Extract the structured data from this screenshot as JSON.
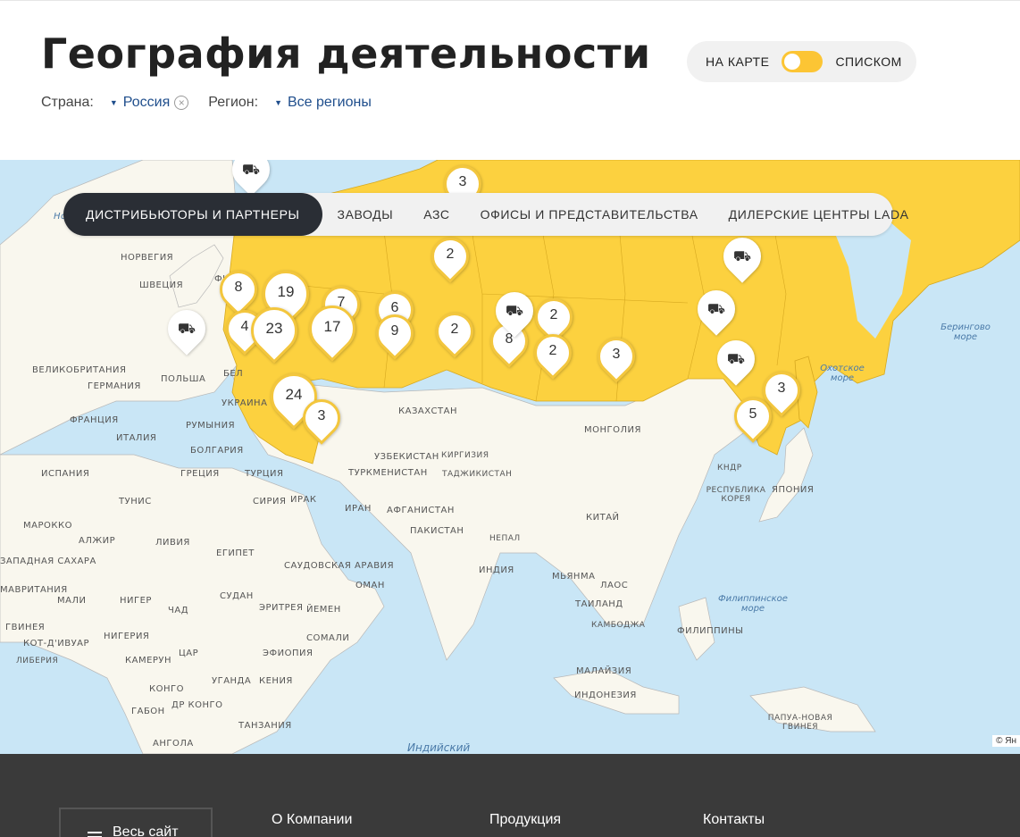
{
  "header": {
    "title": "География деятельности",
    "country_label": "Страна:",
    "country_value": "Россия",
    "region_label": "Регион:",
    "region_value": "Все регионы"
  },
  "view_toggle": {
    "map_label": "НА КАРТЕ",
    "list_label": "СПИСКОМ",
    "selected": "map"
  },
  "tabs": [
    {
      "label": "ДИСТРИБЬЮТОРЫ И ПАРТНЕРЫ",
      "active": true
    },
    {
      "label": "ЗАВОДЫ",
      "active": false
    },
    {
      "label": "АЗС",
      "active": false
    },
    {
      "label": "ОФИСЫ И ПРЕДСТАВИТЕЛЬСТВА",
      "active": false
    },
    {
      "label": "ДИЛЕРСКИЕ ЦЕНТРЫ LADA",
      "active": false
    }
  ],
  "map": {
    "highlight_color": "#fcd13f",
    "water_color": "#c9e6f6",
    "land_color": "#f9f7ee",
    "clusters": [
      "3",
      "2",
      "8",
      "19",
      "7",
      "6",
      "4",
      "23",
      "17",
      "9",
      "2",
      "8",
      "2",
      "2",
      "3",
      "24",
      "3",
      "3",
      "5"
    ],
    "truck_markers": 6,
    "country_labels": [
      "НОРВЕГИЯ",
      "ШВЕЦИЯ",
      "ФИ",
      "ВЕЛИКОБРИТАНИЯ",
      "ГЕРМАНИЯ",
      "ПОЛЬША",
      "БЕЛ",
      "УКРАИНА",
      "ФРАНЦИЯ",
      "РУМЫНИЯ",
      "ИТАЛИЯ",
      "БОЛГАРИЯ",
      "ИСПАНИЯ",
      "ГРЕЦИЯ",
      "ТУРЦИЯ",
      "ТУНИС",
      "СИРИЯ",
      "ИРАК",
      "ИРАН",
      "МАРОККО",
      "АЛЖИР",
      "ЛИВИЯ",
      "ЕГИПЕТ",
      "САУДОВСКАЯ АРАВИЯ",
      "ОМАН",
      "ЙЕМЕН",
      "СУДАН",
      "ЭРИТРЕЯ",
      "ЧАД",
      "НИГЕР",
      "МАЛИ",
      "МАВРИТАНИЯ",
      "ЗАПАДНАЯ САХАРА",
      "ГВИНЕЯ",
      "КОТ-Д'ИВУАР",
      "ЛИБЕРИЯ",
      "НИГЕРИЯ",
      "КАМЕРУН",
      "ЦАР",
      "ЭФИОПИЯ",
      "СОМАЛИ",
      "УГАНДА",
      "КЕНИЯ",
      "КОНГО",
      "ДР КОНГО",
      "ГАБОН",
      "ТАНЗАНИЯ",
      "АНГОЛА",
      "КАЗАХСТАН",
      "УЗБЕКИСТАН",
      "КИРГИЗИЯ",
      "ТУРКМЕНИСТАН",
      "ТАДЖИКИСТАН",
      "АФГАНИСТАН",
      "ПАКИСТАН",
      "НЕПАЛ",
      "ИНДИЯ",
      "МЬЯНМА",
      "ЛАОС",
      "ТАИЛАНД",
      "КАМБОДЖА",
      "МАЛАЙЗИЯ",
      "ИНДОНЕЗИЯ",
      "ФИЛИППИНЫ",
      "КИТАЙ",
      "МОНГОЛИЯ",
      "КНДР",
      "РЕСПУБЛИКА КОРЕЯ",
      "ЯПОНИЯ",
      "ПАПУА-НОВАЯ ГВИНЕЯ",
      "Но"
    ],
    "sea_labels": [
      "Берингово море",
      "Охотское море",
      "Филиппинское море",
      "Индийский"
    ],
    "copyright": "© Ян"
  },
  "footer": {
    "site_button": "Весь сайт",
    "links": [
      "О Компании",
      "Продукция",
      "Контакты"
    ]
  }
}
